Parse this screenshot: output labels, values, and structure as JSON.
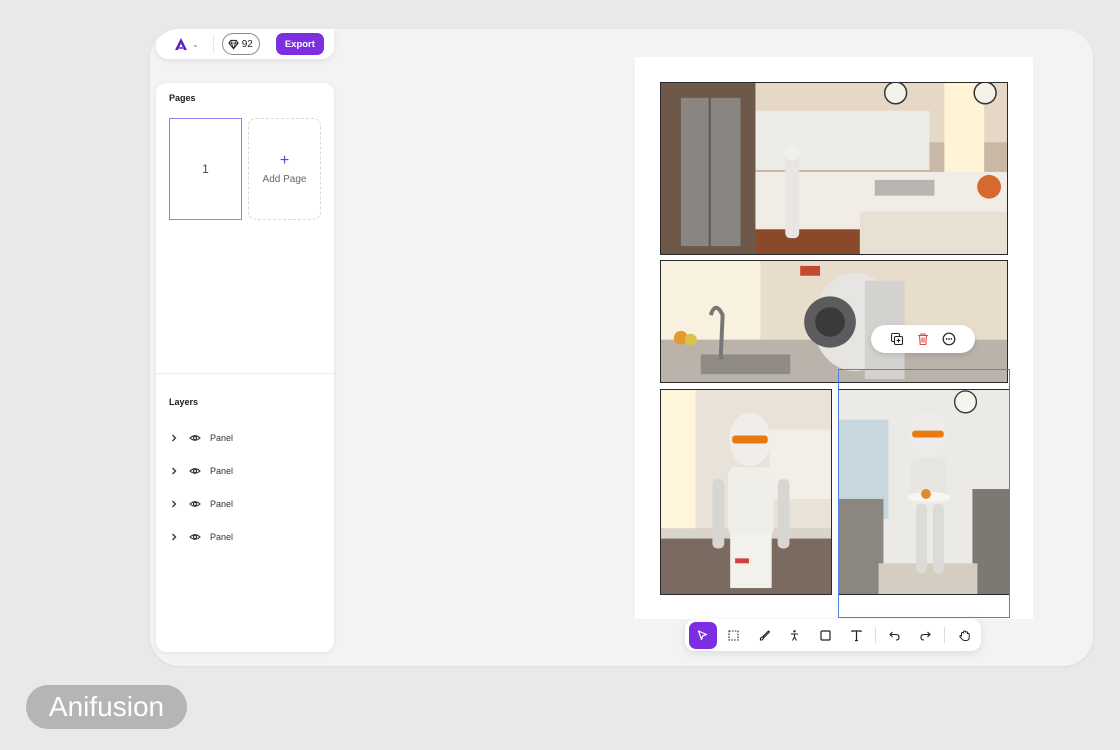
{
  "topbar": {
    "logo_icon": "anifusion-logo-icon",
    "credits_value": "92",
    "export_label": "Export"
  },
  "sidebar": {
    "pages_title": "Pages",
    "pages": [
      {
        "number": "1"
      }
    ],
    "add_page_label": "Add Page",
    "layers_title": "Layers",
    "layers": [
      {
        "label": "Panel"
      },
      {
        "label": "Panel"
      },
      {
        "label": "Panel"
      },
      {
        "label": "Panel"
      }
    ]
  },
  "canvas": {
    "panels": [
      {
        "description_icon": "kitchen-scene-image"
      },
      {
        "description_icon": "robot-closeup-image"
      },
      {
        "description_icon": "robot-standing-image"
      },
      {
        "description_icon": "robot-serving-image"
      }
    ],
    "panel_actions": [
      "duplicate-icon",
      "trash-icon",
      "more-icon"
    ]
  },
  "toolbar": {
    "tools": [
      "select-icon",
      "marquee-icon",
      "brush-icon",
      "pose-icon",
      "rectangle-icon",
      "text-icon",
      "undo-icon",
      "redo-icon",
      "hand-icon"
    ],
    "active_tool": "select-icon"
  },
  "colors": {
    "accent": "#7b2fe0",
    "selection": "#4f7fe0",
    "danger": "#e04848"
  },
  "brand_label": "Anifusion"
}
